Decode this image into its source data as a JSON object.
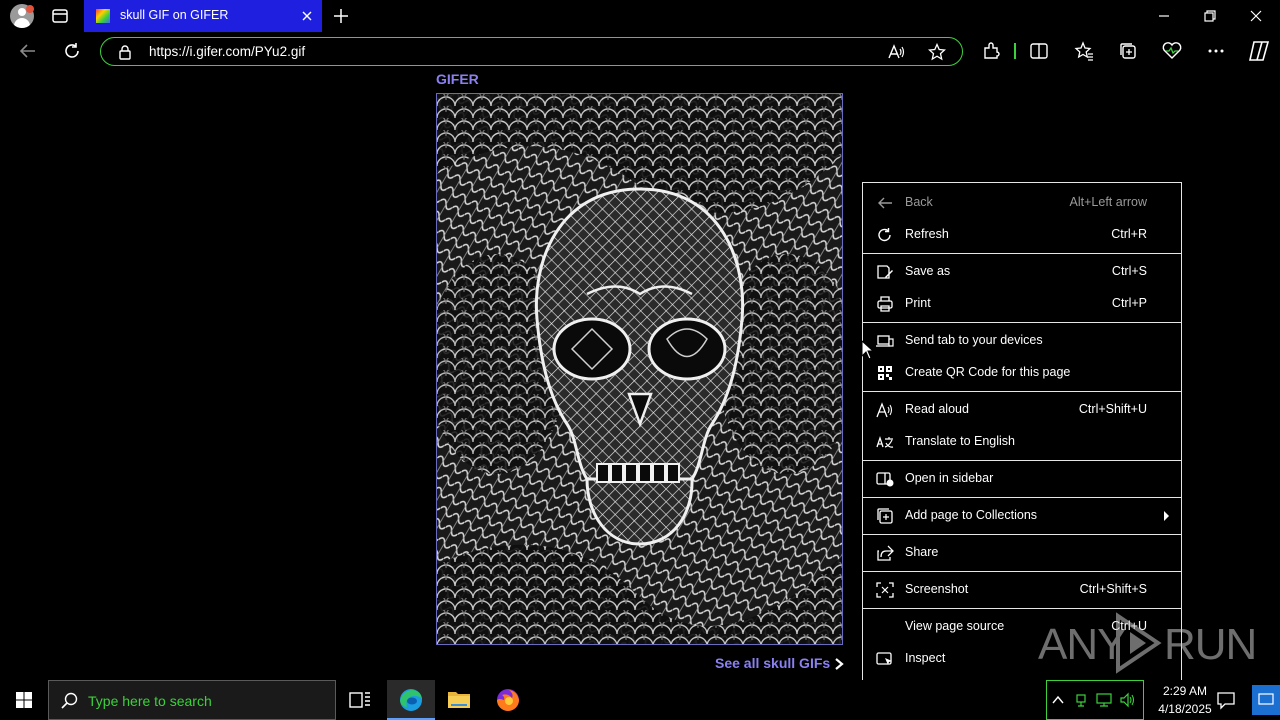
{
  "browser": {
    "tab_title": "skull GIF on GIFER",
    "url": "https://i.gifer.com/PYu2.gif"
  },
  "page": {
    "brand": "GIFER",
    "image_alt": "skull GIF",
    "see_all_label": "See all skull GIFs"
  },
  "context_menu": {
    "items": [
      {
        "label": "Back",
        "shortcut": "Alt+Left arrow",
        "icon": "back-arrow-icon",
        "enabled": false
      },
      {
        "label": "Refresh",
        "shortcut": "Ctrl+R",
        "icon": "refresh-icon",
        "enabled": true
      },
      {
        "label": "Save as",
        "shortcut": "Ctrl+S",
        "icon": "save-as-icon",
        "enabled": true
      },
      {
        "label": "Print",
        "shortcut": "Ctrl+P",
        "icon": "print-icon",
        "enabled": true
      },
      {
        "label": "Send tab to your devices",
        "shortcut": "",
        "icon": "send-tab-icon",
        "enabled": true
      },
      {
        "label": "Create QR Code for this page",
        "shortcut": "",
        "icon": "qr-code-icon",
        "enabled": true
      },
      {
        "label": "Read aloud",
        "shortcut": "Ctrl+Shift+U",
        "icon": "read-aloud-icon",
        "enabled": true
      },
      {
        "label": "Translate to English",
        "shortcut": "",
        "icon": "translate-icon",
        "enabled": true
      },
      {
        "label": "Open in sidebar",
        "shortcut": "",
        "icon": "sidebar-icon",
        "enabled": true
      },
      {
        "label": "Add page to Collections",
        "shortcut": "",
        "icon": "collections-icon",
        "enabled": true,
        "submenu": true
      },
      {
        "label": "Share",
        "shortcut": "",
        "icon": "share-icon",
        "enabled": true
      },
      {
        "label": "Screenshot",
        "shortcut": "Ctrl+Shift+S",
        "icon": "screenshot-icon",
        "enabled": true
      },
      {
        "label": "View page source",
        "shortcut": "Ctrl+U",
        "icon": "",
        "enabled": true
      },
      {
        "label": "Inspect",
        "shortcut": "",
        "icon": "inspect-icon",
        "enabled": true
      }
    ]
  },
  "watermark": {
    "left": "ANY",
    "right": "RUN"
  },
  "taskbar": {
    "search_placeholder": "Type here to search",
    "time": "2:29 AM",
    "date": "4/18/2025"
  },
  "colors": {
    "tab_active": "#1f1fdf",
    "address_border": "#3cd13c",
    "brand_link": "#8a80f0",
    "taskbar_search_text": "#3cd13c"
  }
}
